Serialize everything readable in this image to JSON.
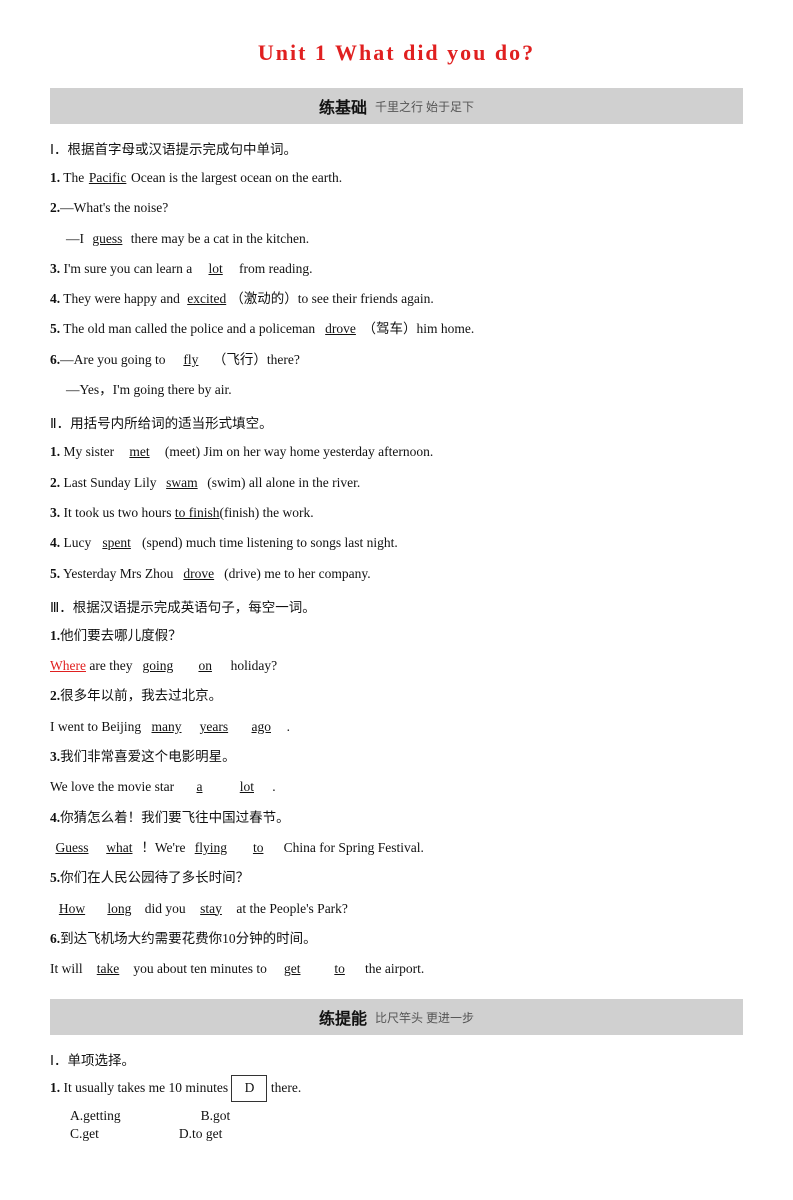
{
  "title": "Unit 1  What did you do?",
  "section1": {
    "label": "练基础",
    "sub": "千里之行  始于足下",
    "part1": {
      "instruction": "Ⅰ．根据首字母或汉语提示完成句中单词。",
      "items": [
        {
          "num": "1.",
          "before": "The ",
          "answer": "Pacific",
          "after": " Ocean is the largest ocean on the earth."
        },
        {
          "num": "2.",
          "lines": [
            "—What's the noise?",
            "—I <u>guess</u> there may be a cat in the kitchen."
          ]
        },
        {
          "num": "3.",
          "text": "I'm sure you can learn a <u>lot</u> from reading."
        },
        {
          "num": "4.",
          "before": "They were happy and ",
          "answer": "excited",
          "cn": "（激动的）",
          "after": "to see their friends again."
        },
        {
          "num": "5.",
          "before": "The old man called the police and a policeman ",
          "answer": "drove",
          "cn": "（驾车）",
          "after": "him home."
        },
        {
          "num": "6.",
          "lines": [
            "—Are you going to <u>fly</u> （飞行）there?",
            "—Yes，I'm going there by air."
          ]
        }
      ]
    },
    "part2": {
      "instruction": "Ⅱ．用括号内所给词的适当形式填空。",
      "items": [
        {
          "num": "1.",
          "before": "My sister ",
          "answer": "met",
          "cn": "(meet)",
          "after": " Jim on her way home yesterday afternoon."
        },
        {
          "num": "2.",
          "before": "Last Sunday Lily ",
          "answer": "swam",
          "cn": "(swim)",
          "after": " all alone in the river."
        },
        {
          "num": "3.",
          "before": "It took us two hours ",
          "answer": "to finish",
          "cn": "(finish)",
          "after": " the work."
        },
        {
          "num": "4.",
          "before": "Lucy ",
          "answer": "spent",
          "cn": "(spend)",
          "after": " much time listening to songs last night."
        },
        {
          "num": "5.",
          "before": "Yesterday Mrs Zhou ",
          "answer": "drove",
          "cn": "(drive)",
          "after": " me to her company."
        }
      ]
    },
    "part3": {
      "instruction": "Ⅲ．根据汉语提示完成英语句子，每空一词。",
      "items": [
        {
          "num": "1.",
          "cn_sentence": "他们要去哪儿度假？",
          "en_before": "",
          "blanks": [
            {
              "text": "Where",
              "red": true
            },
            {
              "text": " are they "
            },
            {
              "text": "going",
              "underline": true
            },
            {
              "text": " "
            },
            {
              "text": "on",
              "underline": true
            },
            {
              "text": " holiday?"
            }
          ]
        },
        {
          "num": "2.",
          "cn_sentence": "很多年以前，我去过北京。",
          "en_before": "I went to Beijing ",
          "blanks_middle": [
            {
              "text": "many",
              "underline": true
            },
            {
              "text": " "
            },
            {
              "text": "years",
              "underline": true
            },
            {
              "text": " "
            },
            {
              "text": "ago",
              "underline": true
            },
            {
              "text": " ."
            }
          ]
        },
        {
          "num": "3.",
          "cn_sentence": "我们非常喜爱这个电影明星。",
          "en_text": "We love the movie star ",
          "blanks3": [
            {
              "text": "a",
              "underline": true
            },
            {
              "text": "   "
            },
            {
              "text": "lot",
              "underline": true
            },
            {
              "text": " ."
            }
          ]
        },
        {
          "num": "4.",
          "cn_sentence": "你猜怎么着！我们要飞往中国过春节。",
          "line1_blanks": [
            {
              "text": "Guess",
              "underline": true,
              "red": false
            },
            {
              "text": " "
            },
            {
              "text": "what",
              "underline": true
            },
            {
              "text": " ！We're "
            },
            {
              "text": "flying",
              "underline": true
            },
            {
              "text": " "
            },
            {
              "text": "to",
              "underline": true
            },
            {
              "text": " China for Spring Festival."
            }
          ]
        },
        {
          "num": "5.",
          "cn_sentence": "你们在人民公园待了多长时间？",
          "line1": [
            {
              "text": "How",
              "underline": true
            },
            {
              "text": " "
            },
            {
              "text": "long",
              "underline": true
            },
            {
              "text": " did you "
            },
            {
              "text": "stay",
              "underline": true
            },
            {
              "text": " at the People's Park?"
            }
          ]
        },
        {
          "num": "6.",
          "cn_sentence": "到达飞机场大约需要花费你10分钟的时间。",
          "line1": [
            {
              "text": "It will "
            },
            {
              "text": "take",
              "underline": true
            },
            {
              "text": " you about ten minutes to "
            },
            {
              "text": "get",
              "underline": true
            },
            {
              "text": "  "
            },
            {
              "text": "to",
              "underline": true
            },
            {
              "text": "  the airport."
            }
          ]
        }
      ]
    }
  },
  "section2": {
    "label": "练提能",
    "sub": "比尺竿头  更进一步",
    "part1": {
      "instruction": "Ⅰ．单项选择。",
      "items": [
        {
          "num": "1.",
          "text": "It usually takes me 10 minutes ",
          "answer": "D",
          "after": " there.",
          "choices": [
            {
              "label": "A.",
              "text": "getting"
            },
            {
              "label": "B.",
              "text": "got"
            },
            {
              "label": "C.",
              "text": "get"
            },
            {
              "label": "D.",
              "text": "to get"
            }
          ]
        }
      ]
    }
  }
}
